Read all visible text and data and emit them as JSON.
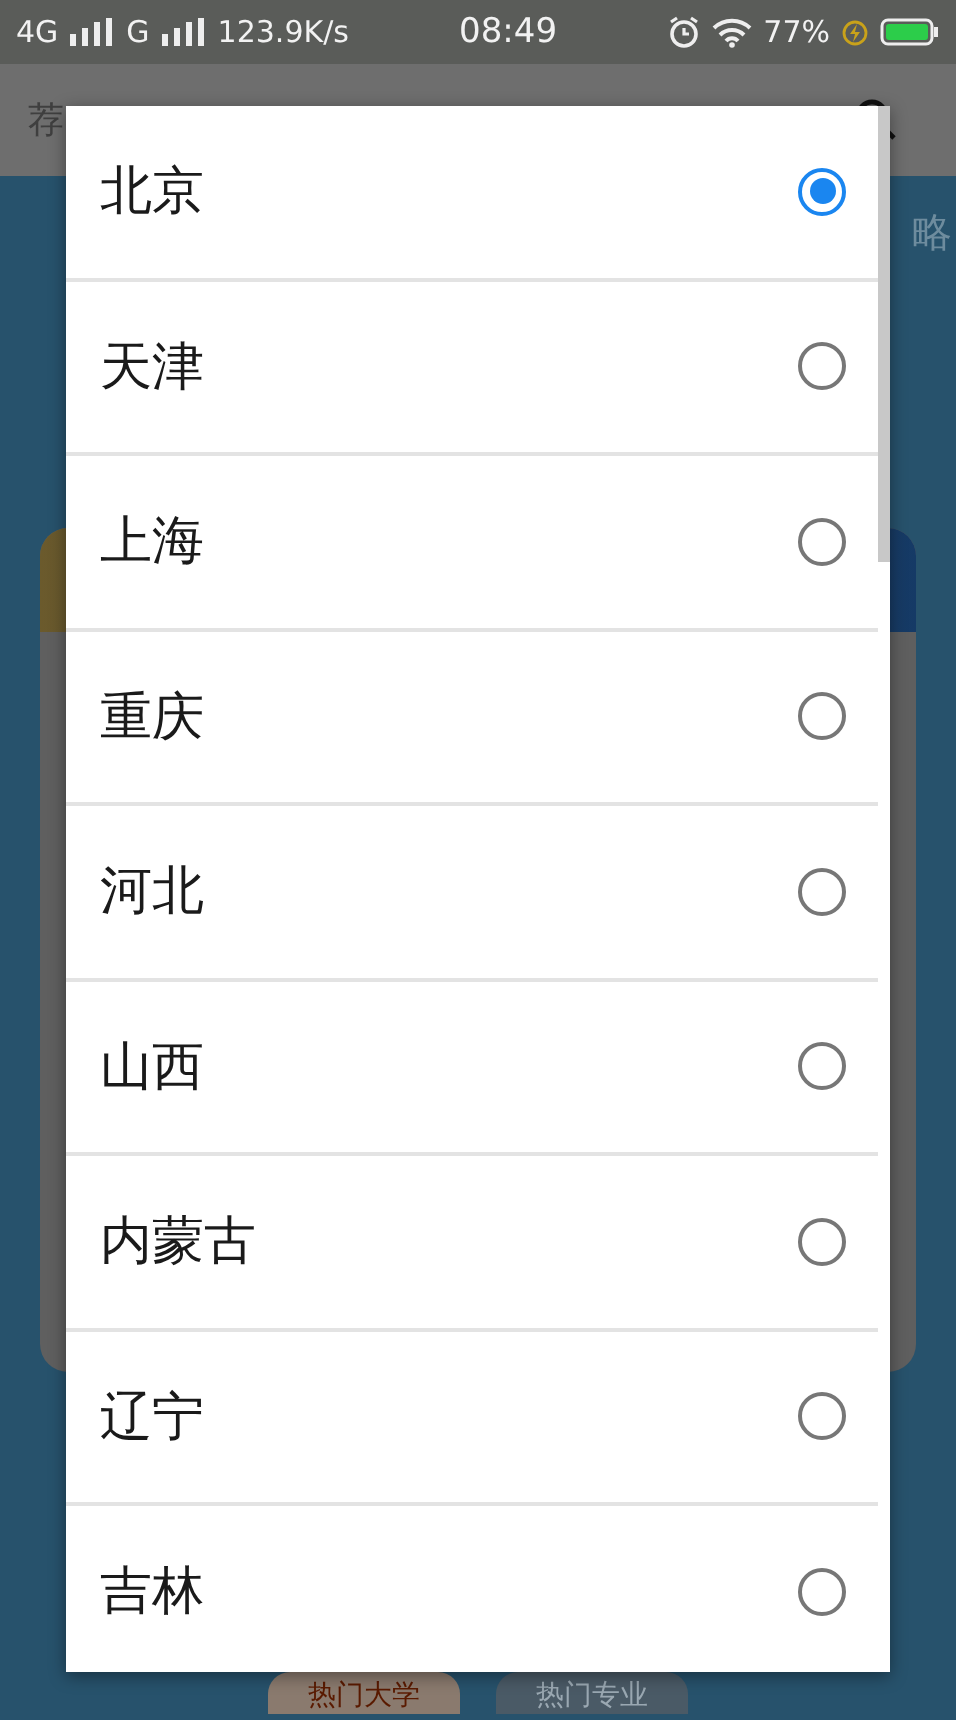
{
  "status_bar": {
    "network_1": "4G",
    "network_2": "G",
    "speed": "123.9K/s",
    "time": "08:49",
    "battery": "77%"
  },
  "header": {
    "tab_left": "荐"
  },
  "tabs_row": {
    "right": "略"
  },
  "bottom_tabs": [
    {
      "label": "热门大学",
      "selected": true
    },
    {
      "label": "热门专业",
      "selected": false
    }
  ],
  "dialog": {
    "options": [
      {
        "label": "北京",
        "selected": true
      },
      {
        "label": "天津",
        "selected": false
      },
      {
        "label": "上海",
        "selected": false
      },
      {
        "label": "重庆",
        "selected": false
      },
      {
        "label": "河北",
        "selected": false
      },
      {
        "label": "山西",
        "selected": false
      },
      {
        "label": "内蒙古",
        "selected": false
      },
      {
        "label": "辽宁",
        "selected": false
      },
      {
        "label": "吉林",
        "selected": false
      }
    ]
  }
}
